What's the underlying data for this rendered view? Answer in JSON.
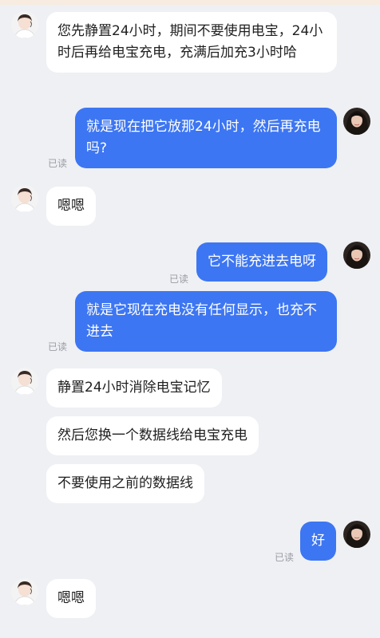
{
  "messages": [
    {
      "side": "in",
      "text": "您先静置24小时，期间不要使用电宝，24小时后再给电宝充电，充满后加充3小时哈"
    },
    {
      "side": "out",
      "text": "就是现在把它放那24小时，然后再充电吗?",
      "status": "已读"
    },
    {
      "side": "in",
      "text": "嗯嗯"
    },
    {
      "side": "out",
      "text": "它不能充进去电呀",
      "status": "已读"
    },
    {
      "side": "out",
      "text": "就是它现在充电没有任何显示，也充不进去",
      "status": "已读"
    },
    {
      "side": "in",
      "text": "静置24小时消除电宝记忆"
    },
    {
      "side": "in",
      "text": "然后您换一个数据线给电宝充电"
    },
    {
      "side": "in",
      "text": "不要使用之前的数据线"
    },
    {
      "side": "out",
      "text": "好",
      "status": "已读"
    },
    {
      "side": "in",
      "text": "嗯嗯"
    }
  ],
  "colors": {
    "background": "#eef0f4",
    "incoming_bubble": "#ffffff",
    "outgoing_bubble": "#3d76f2",
    "read_status": "#9a9ca3"
  },
  "icons": {
    "agent_avatar": "agent-avatar-icon",
    "user_avatar": "user-avatar-icon"
  }
}
